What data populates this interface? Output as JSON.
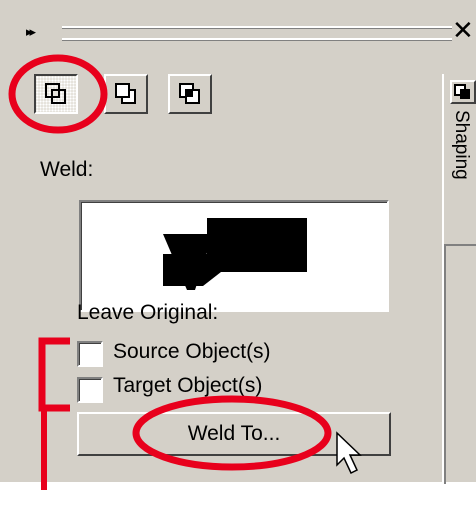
{
  "titlebar": {
    "expand_glyph": "▸▸",
    "close_glyph": "✕"
  },
  "toolbar": {
    "tools": [
      {
        "name": "weld-tool",
        "icon": "weld-icon",
        "pressed": true
      },
      {
        "name": "trim-tool",
        "icon": "trim-icon",
        "pressed": false
      },
      {
        "name": "intersect-tool",
        "icon": "intersect-icon",
        "pressed": false
      }
    ]
  },
  "panel": {
    "section_label": "Weld:",
    "leave_original_label": "Leave Original:",
    "options": [
      {
        "label": "Source Object(s)",
        "checked": false
      },
      {
        "label": "Target Object(s)",
        "checked": false
      }
    ],
    "weld_button_label": "Weld To..."
  },
  "side_tab": {
    "label": "Shaping",
    "icon": "shaping-icon"
  },
  "annotations": {
    "color": "#e8001c",
    "items": [
      "tool-highlight-ellipse",
      "button-highlight-ellipse",
      "checkbox-bracket"
    ]
  },
  "cursor": {
    "icon": "arrow-cursor-icon"
  }
}
